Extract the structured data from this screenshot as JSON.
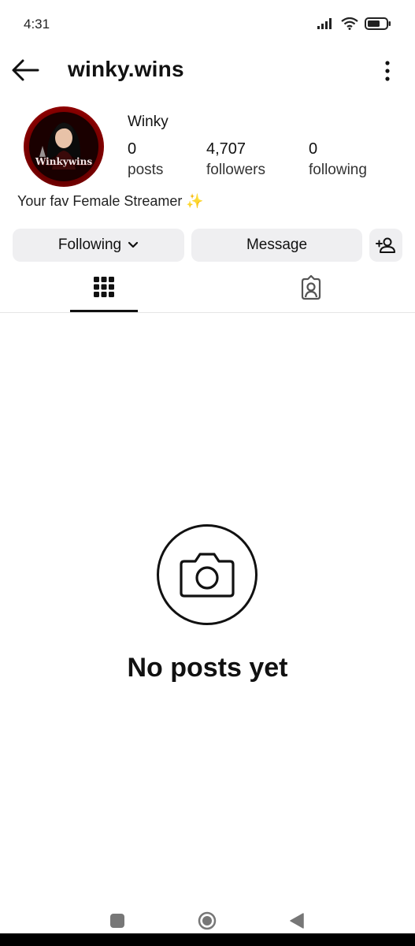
{
  "status": {
    "time": "4:31"
  },
  "profile": {
    "username": "winky.wins",
    "display_name": "Winky",
    "avatar_text": "Winkywins",
    "bio": "Your fav Female Streamer ✨",
    "stats": [
      {
        "value": "0",
        "label": "posts"
      },
      {
        "value": "4,707",
        "label": "followers"
      },
      {
        "value": "0",
        "label": "following"
      }
    ]
  },
  "actions": {
    "following_label": "Following",
    "message_label": "Message"
  },
  "tabs": [
    {
      "icon": "grid-icon",
      "active": true
    },
    {
      "icon": "tagged-icon",
      "active": false
    }
  ],
  "empty_state": {
    "text": "No posts yet",
    "icon": "camera-icon"
  },
  "colors": {
    "button_bg": "#efeff1",
    "text": "#111111",
    "avatar_ring": "#c40000"
  }
}
